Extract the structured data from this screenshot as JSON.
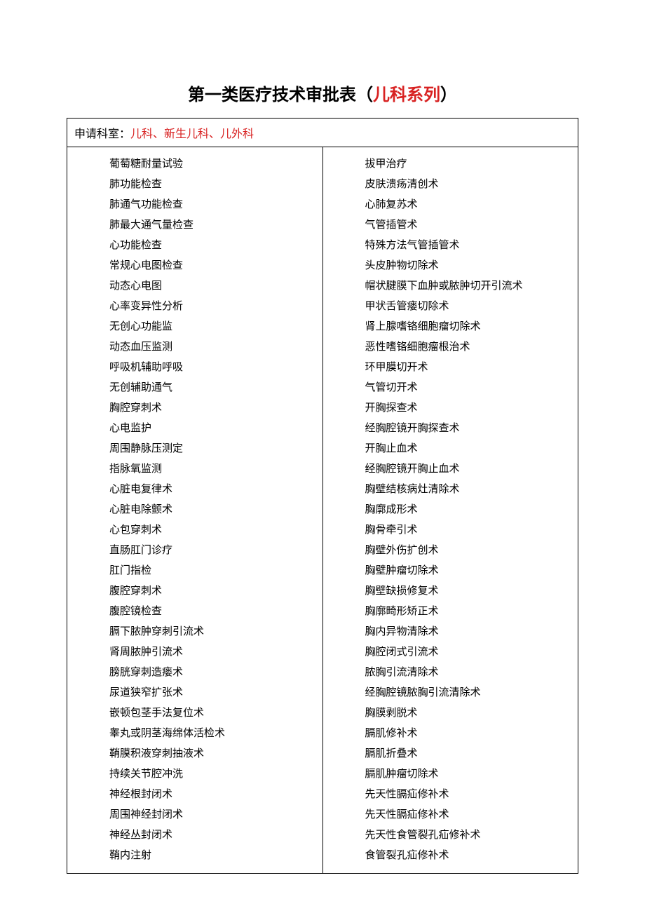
{
  "title": {
    "prefix": "第一类医疗技术审批表（",
    "highlight": "儿科系列",
    "suffix": "）"
  },
  "header": {
    "label": "申请科室：",
    "value": "儿科、新生儿科、儿外科"
  },
  "leftColumn": [
    "葡萄糖耐量试验",
    "肺功能检查",
    "肺通气功能检查",
    "肺最大通气量检查",
    "心功能检查",
    "常规心电图检查",
    "动态心电图",
    "心率变异性分析",
    "无创心功能监",
    "动态血压监测",
    "呼吸机辅助呼吸",
    "无创辅助通气",
    "胸腔穿刺术",
    "心电监护",
    "周围静脉压测定",
    "指脉氧监测",
    "心脏电复律术",
    "心脏电除颤术",
    "心包穿刺术",
    "直肠肛门诊疗",
    "肛门指检",
    "腹腔穿刺术",
    "腹腔镜检查",
    "膈下脓肿穿刺引流术",
    "肾周脓肿引流术",
    "膀胱穿刺造瘘术",
    "尿道狭窄扩张术",
    "嵌顿包茎手法复位术",
    "睾丸或阴茎海绵体活检术",
    "鞘膜积液穿刺抽液术",
    "持续关节腔冲洗",
    "神经根封闭术",
    "周围神经封闭术",
    "神经丛封闭术",
    "鞘内注射"
  ],
  "rightColumn": [
    "拔甲治疗",
    "皮肤溃疡清创术",
    "心肺复苏术",
    "气管插管术",
    "特殊方法气管插管术",
    "头皮肿物切除术",
    "帽状腱膜下血肿或脓肿切开引流术",
    "甲状舌管瘘切除术",
    "肾上腺嗜铬细胞瘤切除术",
    "恶性嗜铬细胞瘤根治术",
    "环甲膜切开术",
    "气管切开术",
    "开胸探查术",
    "经胸腔镜开胸探查术",
    "开胸止血术",
    "经胸腔镜开胸止血术",
    "胸壁结核病灶清除术",
    "胸廓成形术",
    "胸骨牵引术",
    "胸壁外伤扩创术",
    "胸壁肿瘤切除术",
    "胸壁缺损修复术",
    "胸廓畸形矫正术",
    "胸内异物清除术",
    "胸腔闭式引流术",
    "脓胸引流清除术",
    "经胸腔镜脓胸引流清除术",
    "胸膜剥脱术",
    "膈肌修补术",
    "膈肌折叠术",
    "膈肌肿瘤切除术",
    "先天性膈疝修补术",
    "先天性膈疝修补术",
    "先天性食管裂孔疝修补术",
    "食管裂孔疝修补术"
  ]
}
